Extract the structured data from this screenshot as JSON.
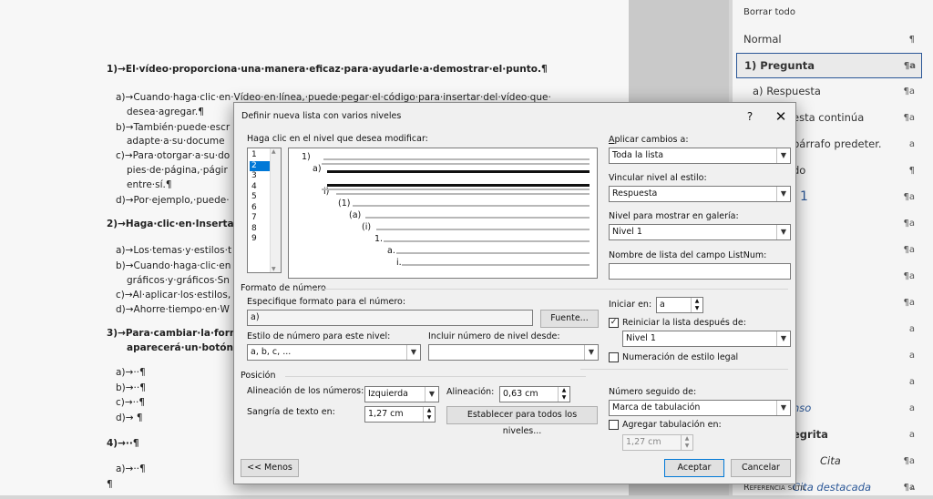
{
  "document": {
    "lines": [
      {
        "text": "1)→El·vídeo·proporciona·una·manera·eficaz·para·ayudarle·a·demostrar·el·punto.¶",
        "bold": true
      },
      {
        "text": "a)→Cuando·haga·clic·en·Vídeo·en·línea,·puede·pegar·el·código·para·insertar·del·vídeo·que·",
        "bold": false
      },
      {
        "text": "desea·agregar.¶",
        "bold": false
      },
      {
        "text": "b)→También·puede·escr",
        "bold": false
      },
      {
        "text": "adapte·a·su·docume",
        "bold": false
      },
      {
        "text": "c)→Para·otorgar·a·su·do",
        "bold": false
      },
      {
        "text": "pies·de·página,·págir",
        "bold": false
      },
      {
        "text": "entre·sí.¶",
        "bold": false
      },
      {
        "text": "d)→Por·ejemplo,·puede·",
        "bold": false
      },
      {
        "text": "2)→Haga·clic·en·Insertar·y·e",
        "bold": true
      },
      {
        "text": "a)→Los·temas·y·estilos·t",
        "bold": false
      },
      {
        "text": "b)→Cuando·haga·clic·en",
        "bold": false
      },
      {
        "text": "gráficos·y·gráficos·Sn",
        "bold": false
      },
      {
        "text": "c)→Al·aplicar·los·estilos,",
        "bold": false
      },
      {
        "text": "d)→Ahorre·tiempo·en·W",
        "bold": false
      },
      {
        "text": "3)→Para·cambiar·la·forma·e",
        "bold": true
      },
      {
        "text": "aparecerá·un·botón·de·",
        "bold": true
      },
      {
        "text": "a)→··¶",
        "bold": false
      },
      {
        "text": "b)→··¶",
        "bold": false
      },
      {
        "text": "c)→··¶",
        "bold": false
      },
      {
        "text": "d)→ ¶",
        "bold": false
      },
      {
        "text": "4)→··¶",
        "bold": true
      },
      {
        "text": "a)→··¶",
        "bold": false
      },
      {
        "text": "¶",
        "bold": false
      }
    ]
  },
  "styles_pane": {
    "clear_all": "Borrar todo",
    "items": [
      {
        "name": "Normal",
        "mark": "¶"
      },
      {
        "name": "1)  Pregunta",
        "mark": "¶a"
      },
      {
        "name": "a)  Respuesta",
        "mark": "¶a"
      },
      {
        "name": "esta continúa",
        "mark": "¶a"
      },
      {
        "name": "párrafo predeter.",
        "mark": "a"
      },
      {
        "name": "do",
        "mark": "¶"
      },
      {
        "name": "1",
        "mark": "¶a"
      },
      {
        "name": "",
        "mark": "¶a"
      },
      {
        "name": "",
        "mark": "¶a"
      },
      {
        "name": "",
        "mark": "¶a"
      },
      {
        "name": "",
        "mark": "¶a"
      },
      {
        "name": "",
        "mark": "a"
      },
      {
        "name": "",
        "mark": "a"
      },
      {
        "name": "",
        "mark": "a"
      },
      {
        "name": "nso",
        "mark": "a"
      },
      {
        "name": "egrita",
        "mark": "a"
      },
      {
        "name": "Cita",
        "mark": "¶a"
      },
      {
        "name": "Cita destacada",
        "mark": "¶a"
      },
      {
        "name": "Referencia sutil",
        "mark": "a"
      }
    ]
  },
  "dialog": {
    "title": "Definir nueva lista con varios niveles",
    "help": "?",
    "close": "✕",
    "level_prompt": "Haga clic en el nivel que desea modificar:",
    "levels": [
      "1",
      "2",
      "3",
      "4",
      "5",
      "6",
      "7",
      "8",
      "9"
    ],
    "selected_level": "2",
    "preview_labels": [
      "1)",
      "a)",
      "i)",
      "(1)",
      "(a)",
      "(i)",
      "1.",
      "a.",
      "i."
    ],
    "apply_label": "Aplicar cambios a:",
    "apply_value": "Toda la lista",
    "link_style_label": "Vincular nivel al estilo:",
    "link_style_value": "Respuesta",
    "gallery_level_label": "Nivel para mostrar en galería:",
    "gallery_level_value": "Nivel 1",
    "listnum_label": "Nombre de lista del campo ListNum:",
    "listnum_value": "",
    "number_format_section": "Formato de número",
    "format_label": "Especifique formato para el número:",
    "format_value": "a)",
    "font_button": "Fuente...",
    "number_style_label": "Estilo de número para este nivel:",
    "number_style_value": "a, b, c, ...",
    "include_level_label": "Incluir número de nivel desde:",
    "include_level_value": "",
    "start_at_label": "Iniciar en:",
    "start_at_value": "a",
    "restart_label": "Reiniciar la lista después de:",
    "restart_checked": true,
    "restart_value": "Nivel 1",
    "legal_label": "Numeración de estilo legal",
    "legal_checked": false,
    "position_section": "Posición",
    "number_align_label": "Alineación de los números:",
    "number_align_value": "Izquierda",
    "align_at_label": "Alineación:",
    "align_at_value": "0,63 cm",
    "indent_label": "Sangría de texto en:",
    "indent_value": "1,27 cm",
    "set_all_button": "Establecer para todos los niveles...",
    "followed_by_label": "Número seguido de:",
    "followed_by_value": "Marca de tabulación",
    "add_tab_label": "Agregar tabulación en:",
    "add_tab_checked": false,
    "add_tab_value": "1,27 cm",
    "less_button": "<< Menos",
    "ok_button": "Aceptar",
    "cancel_button": "Cancelar"
  }
}
